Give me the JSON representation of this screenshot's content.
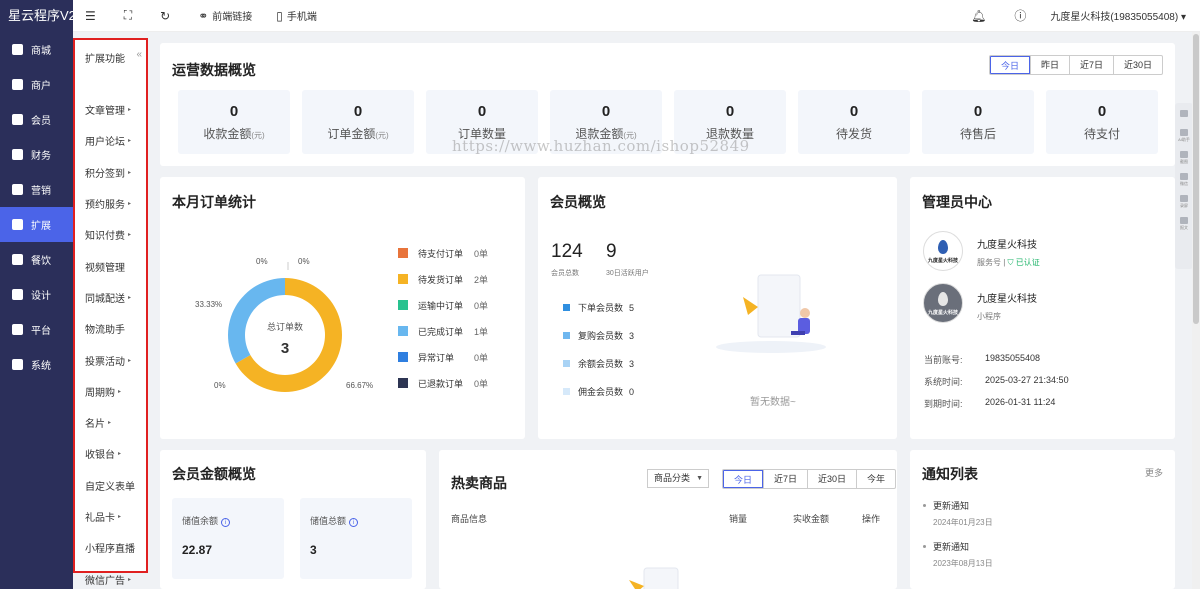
{
  "brand": "星云程序V2",
  "nav": [
    {
      "label": "商城",
      "icon": "shop-icon"
    },
    {
      "label": "商户",
      "icon": "merchant-icon"
    },
    {
      "label": "会员",
      "icon": "member-icon"
    },
    {
      "label": "财务",
      "icon": "finance-icon"
    },
    {
      "label": "营销",
      "icon": "marketing-icon"
    },
    {
      "label": "扩展",
      "icon": "extension-icon"
    },
    {
      "label": "餐饮",
      "icon": "catering-icon"
    },
    {
      "label": "设计",
      "icon": "design-icon"
    },
    {
      "label": "平台",
      "icon": "platform-icon"
    },
    {
      "label": "系统",
      "icon": "system-icon"
    }
  ],
  "submenu": {
    "title": "扩展功能",
    "collapse": "«",
    "items": [
      "文章管理",
      "用户论坛",
      "积分签到",
      "预约服务",
      "知识付费",
      "视频管理",
      "同城配送",
      "物流助手",
      "投票活动",
      "周期购",
      "名片",
      "收银台",
      "自定义表单",
      "礼品卡",
      "小程序直播",
      "微信广告"
    ],
    "arrow": "▸"
  },
  "topbar": {
    "frontend_link": "前端链接",
    "mobile": "手机端",
    "user": "九度星火科技(19835055408)"
  },
  "ops": {
    "title": "运营数据概览",
    "ranges": [
      "今日",
      "昨日",
      "近7日",
      "近30日"
    ],
    "stats": [
      {
        "value": "0",
        "label": "收款金额",
        "unit": "(元)"
      },
      {
        "value": "0",
        "label": "订单金额",
        "unit": "(元)"
      },
      {
        "value": "0",
        "label": "订单数量",
        "unit": ""
      },
      {
        "value": "0",
        "label": "退款金额",
        "unit": "(元)"
      },
      {
        "value": "0",
        "label": "退款数量",
        "unit": ""
      },
      {
        "value": "0",
        "label": "待发货",
        "unit": ""
      },
      {
        "value": "0",
        "label": "待售后",
        "unit": ""
      },
      {
        "value": "0",
        "label": "待支付",
        "unit": ""
      }
    ]
  },
  "watermark": "https://www.huzhan.com/ishop52849",
  "order_stats": {
    "title": "本月订单统计",
    "center_label": "总订单数",
    "center_value": "3",
    "legend": [
      {
        "name": "待支付订单",
        "count": "0单",
        "color": "#e8743b"
      },
      {
        "name": "待发货订单",
        "count": "2单",
        "color": "#f5b324"
      },
      {
        "name": "运输中订单",
        "count": "0单",
        "color": "#28c28f"
      },
      {
        "name": "已完成订单",
        "count": "1单",
        "color": "#68b7ef"
      },
      {
        "name": "异常订单",
        "count": "0单",
        "color": "#2f7fe0"
      },
      {
        "name": "已退款订单",
        "count": "0单",
        "color": "#2d3553"
      }
    ],
    "slice_labels": {
      "l0a": "0%",
      "l0b": "0%",
      "l33": "33.33%",
      "l0c": "0%",
      "l66": "66.67%"
    }
  },
  "chart_data": {
    "type": "pie",
    "title": "本月订单统计",
    "categories": [
      "待支付订单",
      "待发货订单",
      "运输中订单",
      "已完成订单",
      "异常订单",
      "已退款订单"
    ],
    "values": [
      0,
      2,
      0,
      1,
      0,
      0
    ],
    "total": 3
  },
  "member": {
    "title": "会员概览",
    "total": "124",
    "total_label": "会员总数",
    "active": "9",
    "active_label": "30日活跃用户",
    "rows": [
      {
        "label": "下单会员数",
        "count": "5",
        "color": "#2f8fe0"
      },
      {
        "label": "复购会员数",
        "count": "3",
        "color": "#6fb7ef"
      },
      {
        "label": "余额会员数",
        "count": "3",
        "color": "#a9d3f5"
      },
      {
        "label": "佣金会员数",
        "count": "0",
        "color": "#d6e9fa"
      }
    ],
    "empty": "暂无数据~"
  },
  "admin": {
    "title": "管理员中心",
    "accounts": [
      {
        "name": "九度星火科技",
        "type": "服务号",
        "verified": "已认证",
        "logo_text": "九度星火科技"
      },
      {
        "name": "九度星火科技",
        "type": "小程序",
        "logo_text": "九度星火科技"
      }
    ],
    "info": [
      {
        "k": "当前账号:",
        "v": "19835055408"
      },
      {
        "k": "系统时间:",
        "v": "2025-03-27 21:34:50"
      },
      {
        "k": "到期时间:",
        "v": "2026-01-31 11:24"
      }
    ]
  },
  "money": {
    "title": "会员金额概览",
    "boxes": [
      {
        "label": "储值余额",
        "value": "22.87"
      },
      {
        "label": "储值总额",
        "value": "3"
      }
    ]
  },
  "hot": {
    "title": "热卖商品",
    "select": "商品分类",
    "ranges": [
      "今日",
      "近7日",
      "近30日",
      "今年"
    ],
    "cols": [
      "商品信息",
      "销量",
      "实收金额",
      "操作"
    ]
  },
  "notice": {
    "title": "通知列表",
    "more": "更多",
    "items": [
      {
        "title": "更新通知",
        "date": "2024年01月23日"
      },
      {
        "title": "更新通知",
        "date": "2023年08月13日"
      }
    ]
  },
  "float_tools": [
    "AI助手",
    "截图",
    "微信",
    "录屏",
    "报文"
  ]
}
